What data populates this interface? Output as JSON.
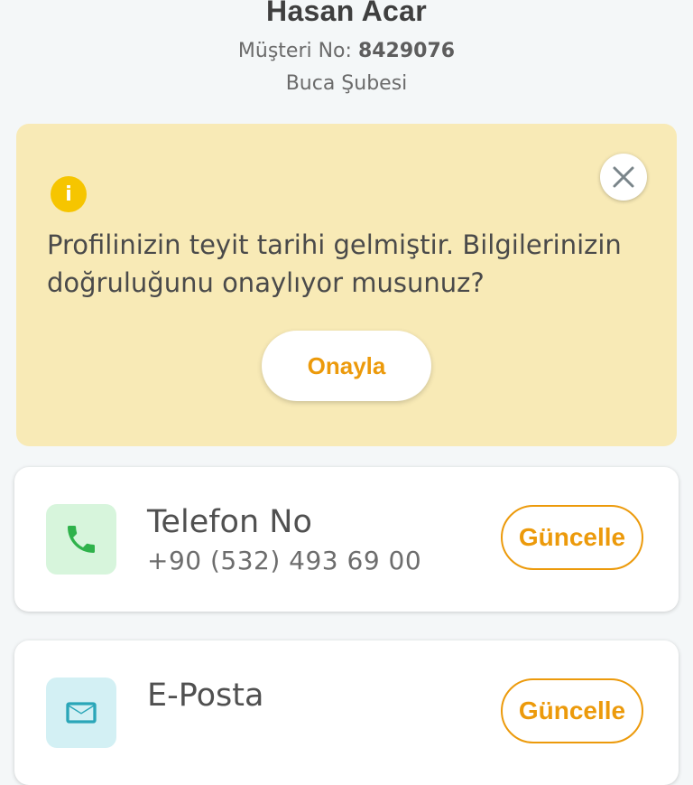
{
  "profile": {
    "name": "Hasan Acar",
    "customer_no_label": "Müşteri No:",
    "customer_no": "8429076",
    "branch": "Buca Şubesi"
  },
  "alert": {
    "icon": "info-icon",
    "icon_glyph": "i",
    "message": "Profilinizin teyit tarihi gelmiştir. Bilgilerinizin doğruluğunu onaylıyor musunuz?",
    "confirm_label": "Onayla",
    "close_icon": "close-icon"
  },
  "contacts": [
    {
      "label": "Telefon No",
      "value": "+90 (532) 493 69 00",
      "icon": "phone-icon",
      "action_label": "Güncelle"
    },
    {
      "label": "E-Posta",
      "icon": "mail-icon",
      "action_label": "Güncelle"
    }
  ],
  "colors": {
    "accent": "#ec9a0b",
    "alert_bg": "#f8eab6",
    "info_icon": "#f6c500",
    "phone_icon": "#2fb24b",
    "page_bg": "#f4f7f8"
  }
}
